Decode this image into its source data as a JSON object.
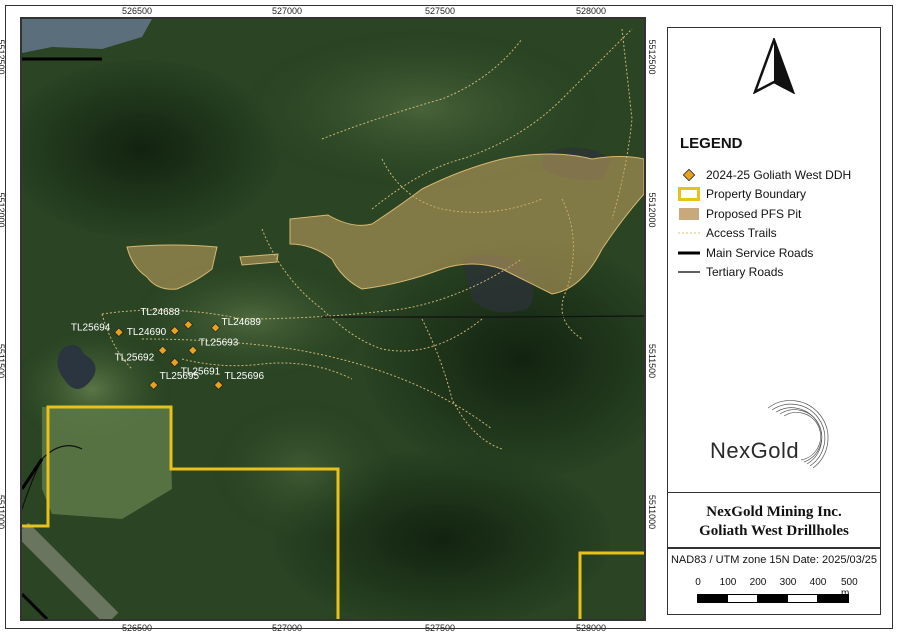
{
  "map": {
    "x_ticks": [
      "526500",
      "527000",
      "527500",
      "528000"
    ],
    "y_ticks": [
      "5512500",
      "5512000",
      "5511500",
      "5511000"
    ],
    "drillholes": [
      {
        "id": "TL25694",
        "easting": 526440,
        "northing": 5511595
      },
      {
        "id": "TL24688",
        "easting": 526670,
        "northing": 5511620
      },
      {
        "id": "TL24690",
        "easting": 526625,
        "northing": 5511600
      },
      {
        "id": "TL24689",
        "easting": 526760,
        "northing": 5511610
      },
      {
        "id": "TL25693",
        "easting": 526685,
        "northing": 5511535
      },
      {
        "id": "TL25692",
        "easting": 526585,
        "northing": 5511535
      },
      {
        "id": "TL25691",
        "easting": 526625,
        "northing": 5511495
      },
      {
        "id": "TL25695",
        "easating_note": "",
        "easting": 526555,
        "northing": 5511420
      },
      {
        "id": "TL25696",
        "easting": 526770,
        "northing": 5511420
      }
    ],
    "colors": {
      "drillhole": "#e8a21f",
      "property_boundary": "#e8c21a",
      "pfs_pit": "#c9a562",
      "access_trails": "#e0c07a",
      "main_roads": "#000000",
      "tertiary_roads": "#000000",
      "forest": "#243d1e"
    }
  },
  "legend": {
    "north_icon": "north-arrow-icon",
    "title": "LEGEND",
    "items": [
      {
        "label": "2024-25 Goliath West DDH",
        "symbol": "diamond-icon"
      },
      {
        "label": "Property Boundary",
        "symbol": "yellow-outline-box"
      },
      {
        "label": "Proposed PFS Pit",
        "symbol": "tan-fill-box"
      },
      {
        "label": "Access Trails",
        "symbol": "dotted-line"
      },
      {
        "label": "Main Service Roads",
        "symbol": "thick-line"
      },
      {
        "label": "Tertiary Roads",
        "symbol": "thin-line"
      }
    ],
    "logo": {
      "text": "NexGold",
      "icon": "nexgold-ring-logo"
    }
  },
  "title": {
    "line1": "NexGold Mining Inc.",
    "line2": "Goliath West Drillholes"
  },
  "scale": {
    "projection": "NAD83 / UTM zone 15N Date: 2025/03/25",
    "labels": [
      "0",
      "100",
      "200",
      "300",
      "400",
      "500 m"
    ]
  }
}
